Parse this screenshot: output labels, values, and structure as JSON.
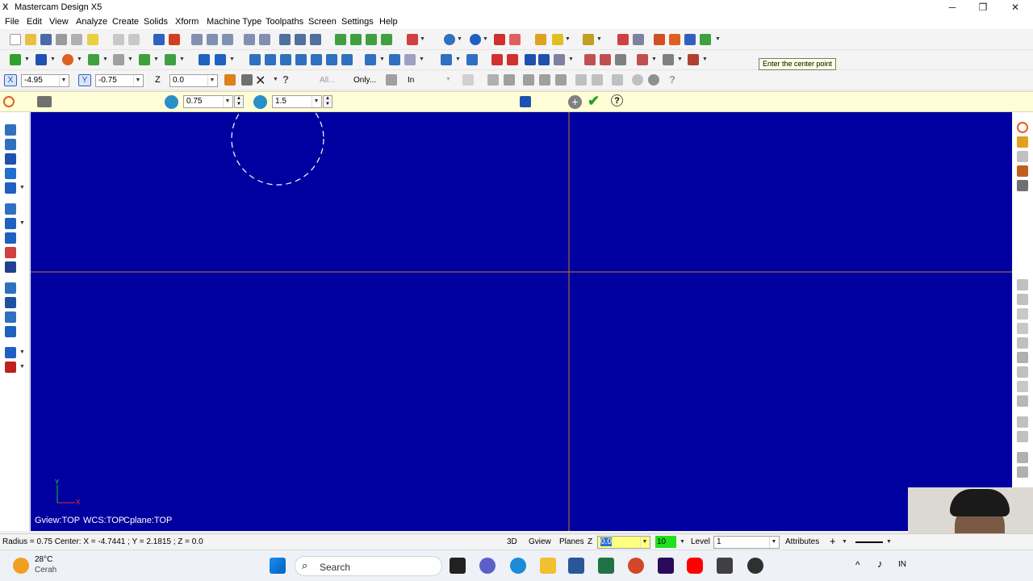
{
  "app": {
    "title": "Mastercam Design X5"
  },
  "window_buttons": {
    "minimize": "─",
    "restore": "❐",
    "close": "✕"
  },
  "menu": [
    "File",
    "Edit",
    "View",
    "Analyze",
    "Create",
    "Solids",
    "Xform",
    "Machine Type",
    "Toolpaths",
    "Screen",
    "Settings",
    "Help"
  ],
  "tooltip": "Enter the center point",
  "autocursor": {
    "x_label": "X",
    "x_value": "-4.95",
    "y_label": "Y",
    "y_value": "-0.75",
    "z_label": "Z",
    "z_value": "0.0",
    "all_label": "All...",
    "only_label": "Only...",
    "in_label": "In"
  },
  "ribbon": {
    "radius_value": "0.75",
    "diameter_value": "1.5"
  },
  "viewport": {
    "gview": "Gview:TOP",
    "wcs": "WCS:TOP",
    "cplane": "Cplane:TOP",
    "axis_y": "Y",
    "axis_x": "X",
    "background_color": "#0000a0",
    "axis_line_color": "#c87832",
    "preview_color": "#ffffff"
  },
  "status": {
    "prompt": "Radius = 0.75 Center: X = -4.7441 ; Y = 2.1815 ; Z = 0.0",
    "mode_3d": "3D",
    "gview": "Gview",
    "planes": "Planes",
    "z_label": "Z",
    "z_value": "0.0",
    "color_value": "10",
    "level_label": "Level",
    "level_value": "1",
    "attributes": "Attributes",
    "attr_plus": "+"
  },
  "taskbar": {
    "temperature": "28°C",
    "weather": "Cerah",
    "search": "Search",
    "lang": "IN"
  }
}
